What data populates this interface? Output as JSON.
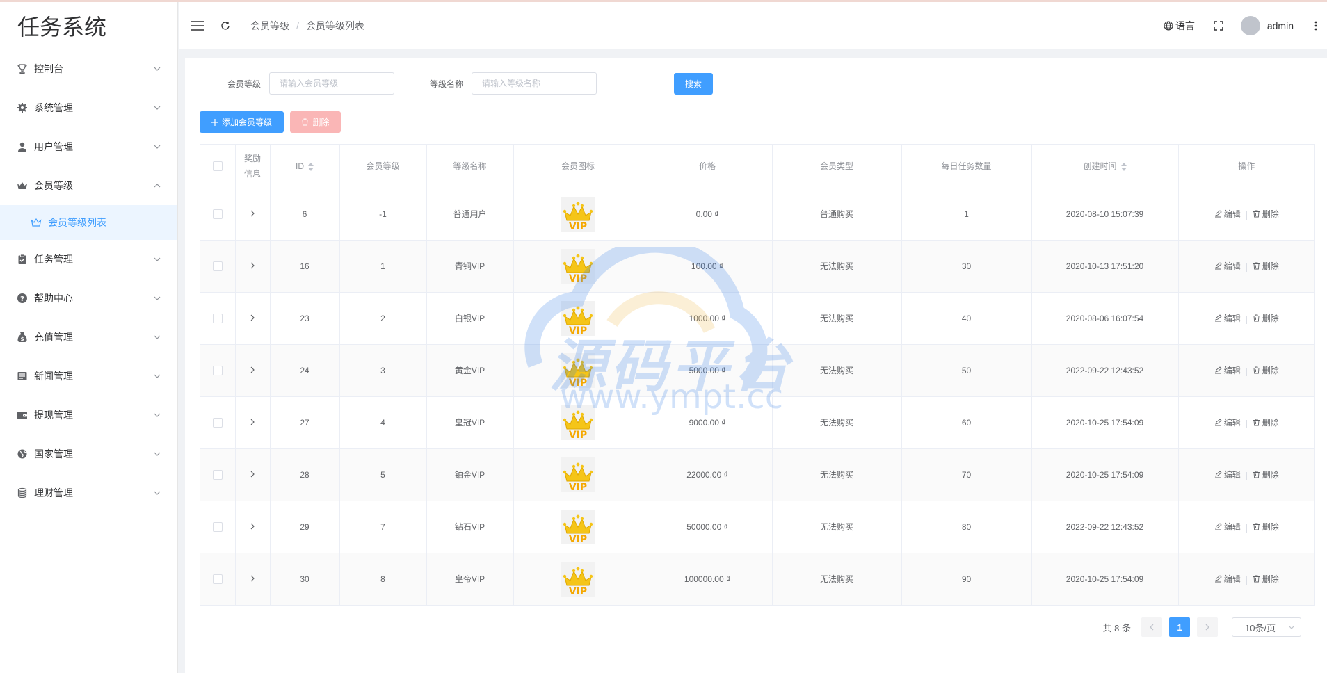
{
  "app": {
    "title": "任务系统"
  },
  "sidebar": {
    "items": [
      {
        "label": "控制台",
        "icon": "trophy-icon"
      },
      {
        "label": "系统管理",
        "icon": "gear-icon"
      },
      {
        "label": "用户管理",
        "icon": "user-icon"
      },
      {
        "label": "会员等级",
        "icon": "crown-icon",
        "expanded": true
      },
      {
        "label": "任务管理",
        "icon": "clipboard-icon"
      },
      {
        "label": "帮助中心",
        "icon": "question-icon"
      },
      {
        "label": "充值管理",
        "icon": "money-bag-icon"
      },
      {
        "label": "新闻管理",
        "icon": "news-icon"
      },
      {
        "label": "提现管理",
        "icon": "wallet-icon"
      },
      {
        "label": "国家管理",
        "icon": "globe-icon"
      },
      {
        "label": "理财管理",
        "icon": "coins-icon"
      }
    ],
    "subitem": {
      "label": "会员等级列表",
      "icon": "crown-outline-icon"
    }
  },
  "header": {
    "breadcrumb": [
      "会员等级",
      "会员等级列表"
    ],
    "language": "语言",
    "username": "admin"
  },
  "search": {
    "level_label": "会员等级",
    "level_placeholder": "请输入会员等级",
    "name_label": "等级名称",
    "name_placeholder": "请输入等级名称",
    "search_button": "搜索"
  },
  "toolbar": {
    "add_label": "添加会员等级",
    "delete_label": "删除"
  },
  "table": {
    "columns": {
      "reward": "奖励信息",
      "id": "ID",
      "level": "会员等级",
      "name": "等级名称",
      "icon": "会员图标",
      "price": "价格",
      "type": "会员类型",
      "daily": "每日任务数量",
      "created": "创建时间",
      "ops": "操作"
    },
    "edit_label": "编辑",
    "delete_label": "删除",
    "rows": [
      {
        "id": "6",
        "level": "-1",
        "name": "普通用户",
        "price": "0.00 ₫",
        "type": "普通购买",
        "daily": "1",
        "created": "2020-08-10 15:07:39"
      },
      {
        "id": "16",
        "level": "1",
        "name": "青铜VIP",
        "price": "100.00 ₫",
        "type": "无法购买",
        "daily": "30",
        "created": "2020-10-13 17:51:20"
      },
      {
        "id": "23",
        "level": "2",
        "name": "白银VIP",
        "price": "1000.00 ₫",
        "type": "无法购买",
        "daily": "40",
        "created": "2020-08-06 16:07:54"
      },
      {
        "id": "24",
        "level": "3",
        "name": "黄金VIP",
        "price": "5000.00 ₫",
        "type": "无法购买",
        "daily": "50",
        "created": "2022-09-22 12:43:52"
      },
      {
        "id": "27",
        "level": "4",
        "name": "皇冠VIP",
        "price": "9000.00 ₫",
        "type": "无法购买",
        "daily": "60",
        "created": "2020-10-25 17:54:09"
      },
      {
        "id": "28",
        "level": "5",
        "name": "铂金VIP",
        "price": "22000.00 ₫",
        "type": "无法购买",
        "daily": "70",
        "created": "2020-10-25 17:54:09"
      },
      {
        "id": "29",
        "level": "7",
        "name": "钻石VIP",
        "price": "50000.00 ₫",
        "type": "无法购买",
        "daily": "80",
        "created": "2022-09-22 12:43:52"
      },
      {
        "id": "30",
        "level": "8",
        "name": "皇帝VIP",
        "price": "100000.00 ₫",
        "type": "无法购买",
        "daily": "90",
        "created": "2020-10-25 17:54:09"
      }
    ]
  },
  "pagination": {
    "total": "共 8 条",
    "current": "1",
    "page_size": "10条/页"
  },
  "watermark": {
    "text": "源码平台",
    "url": "www.ympt.cc"
  },
  "colors": {
    "primary": "#409eff",
    "danger_disabled": "#fab6b6",
    "active_bg": "#ecf5ff",
    "vip_gold": "#f5c518"
  }
}
